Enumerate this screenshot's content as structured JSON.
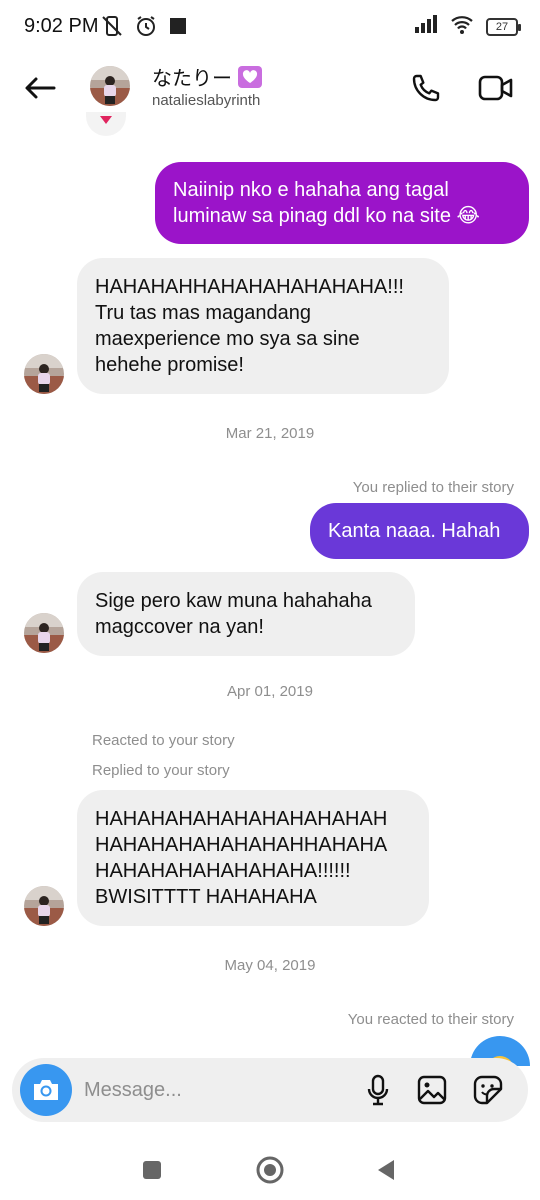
{
  "status_bar": {
    "time": "9:02 PM",
    "battery": "27"
  },
  "header": {
    "contact_name": "なたりー",
    "username": "natalieslabyrinth"
  },
  "messages": [
    {
      "direction": "out",
      "text": "Naiinip nko e hahaha ang tagal luminaw sa pinag ddl ko na site 😂"
    },
    {
      "direction": "in",
      "text": "HAHAHAHHAHAHAHAHAHAHA!!! Tru tas mas magandang maexperience mo sya sa sine hehehe promise!"
    },
    {
      "date": "Mar 21, 2019"
    },
    {
      "note": "You replied to their story"
    },
    {
      "direction": "out",
      "text": "Kanta naaa. Hahah"
    },
    {
      "direction": "in",
      "text": "Sige pero kaw muna hahahaha magccover na yan!"
    },
    {
      "date": "Apr 01, 2019"
    },
    {
      "note": "Reacted to your story"
    },
    {
      "note": "Replied to your story"
    },
    {
      "direction": "in",
      "text": "HAHAHAHAHAHAHAHAHAHAH HAHAHAHAHAHAHAHHAHAHA HAHAHAHAHAHAHAHA!!!!!! BWISITTTT HAHAHAHA"
    },
    {
      "date": "May 04, 2019"
    },
    {
      "note": "You reacted to their story"
    }
  ],
  "composer": {
    "placeholder": "Message..."
  },
  "colors": {
    "bubble_out_purple": "#9b14c9",
    "bubble_out_violet": "#6a38d8",
    "bubble_in": "#efefef",
    "accent_blue": "#3897f0",
    "meta_gray": "#8e8e8e"
  },
  "icons": {
    "back": "arrow-left-icon",
    "call": "phone-icon",
    "video": "video-camera-icon",
    "camera": "camera-icon",
    "mic": "microphone-icon",
    "gallery": "image-icon",
    "sticker": "sticker-icon",
    "nav_recents": "square-icon",
    "nav_home": "circle-icon",
    "nav_back": "triangle-back-icon"
  }
}
